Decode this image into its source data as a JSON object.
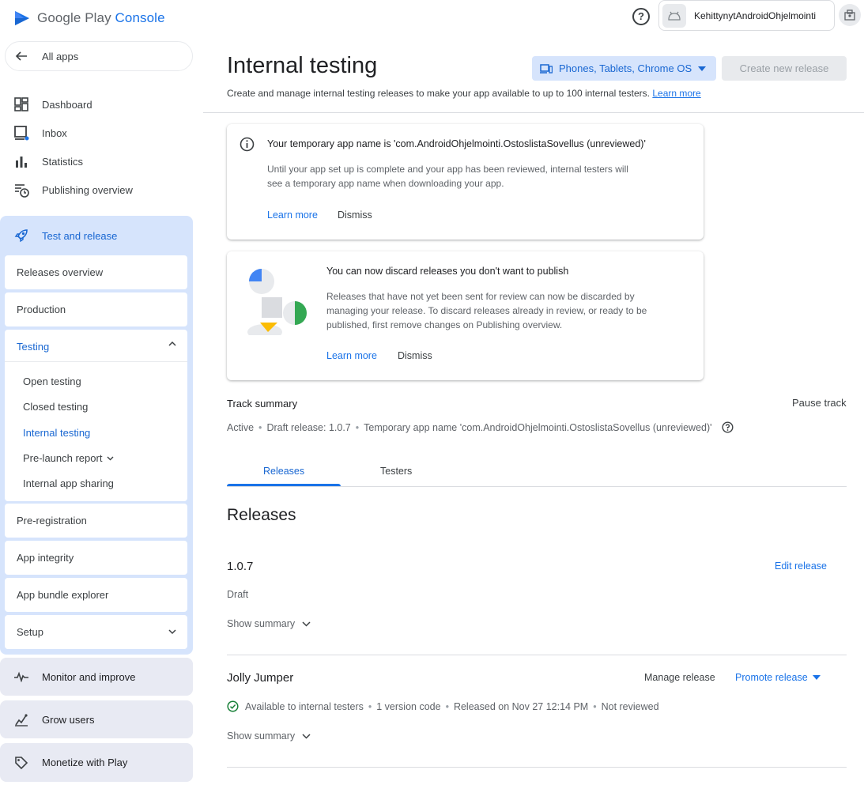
{
  "brand": {
    "google_play": "Google Play",
    "console": "Console"
  },
  "account": {
    "name": "KehittynytAndroidOhjelmointi"
  },
  "sidebar": {
    "all_apps": "All apps",
    "items": [
      {
        "label": "Dashboard",
        "icon": "dashboard-icon"
      },
      {
        "label": "Inbox",
        "icon": "inbox-icon"
      },
      {
        "label": "Statistics",
        "icon": "bar-chart-icon"
      },
      {
        "label": "Publishing overview",
        "icon": "publishing-icon"
      }
    ],
    "test_release": {
      "label": "Test and release",
      "releases_overview": "Releases overview",
      "production": "Production",
      "testing": {
        "label": "Testing",
        "subitems": [
          "Open testing",
          "Closed testing",
          "Internal testing",
          "Pre-launch report",
          "Internal app sharing"
        ]
      },
      "pre_registration": "Pre-registration",
      "app_integrity": "App integrity",
      "app_bundle_explorer": "App bundle explorer",
      "setup": "Setup"
    },
    "groups": [
      "Monitor and improve",
      "Grow users",
      "Monetize with Play"
    ]
  },
  "page": {
    "title": "Internal testing",
    "subtitle": "Create and manage internal testing releases to make your app available to up to 100 internal testers.",
    "learn_more": "Learn more",
    "form_factor": "Phones, Tablets, Chrome OS",
    "create_release": "Create new release"
  },
  "info_card": {
    "title": "Your temporary app name is 'com.AndroidOhjelmointi.OstoslistaSovellus (unreviewed)'",
    "body_line1": "Until your app set up is complete and your app has been reviewed, internal testers will",
    "body_line2": "see a temporary app name when downloading your app.",
    "learn_more": "Learn more",
    "dismiss": "Dismiss"
  },
  "discard_card": {
    "title": "You can now discard releases you don't want to publish",
    "body_line1": "Releases that have not yet been sent for review can now be discarded by",
    "body_line2": "managing your release. To discard releases already in review, or ready to be",
    "body_line3": "published, first remove changes on Publishing overview.",
    "learn_more": "Learn more",
    "dismiss": "Dismiss"
  },
  "track_summary": {
    "title": "Track summary",
    "pause": "Pause track",
    "status": "Active",
    "draft": "Draft release: 1.0.7",
    "temp_name": "Temporary app name 'com.AndroidOhjelmointi.OstoslistaSovellus (unreviewed)'"
  },
  "tabs": [
    "Releases",
    "Testers"
  ],
  "releases": {
    "title": "Releases",
    "draft": {
      "version": "1.0.7",
      "edit": "Edit release",
      "status": "Draft",
      "show_summary": "Show summary"
    },
    "live": {
      "name": "Jolly Jumper",
      "manage": "Manage release",
      "promote": "Promote release",
      "available": "Available to internal testers",
      "version_codes": "1 version code",
      "released": "Released on Nov 27 12:14 PM",
      "review": "Not reviewed",
      "show_summary": "Show summary"
    }
  },
  "colors": {
    "accent": "#1a73e8",
    "active_text": "#1967d2",
    "selected_section": "#d6e4fc",
    "group_bg": "#e8eaf3",
    "success": "#188038"
  }
}
